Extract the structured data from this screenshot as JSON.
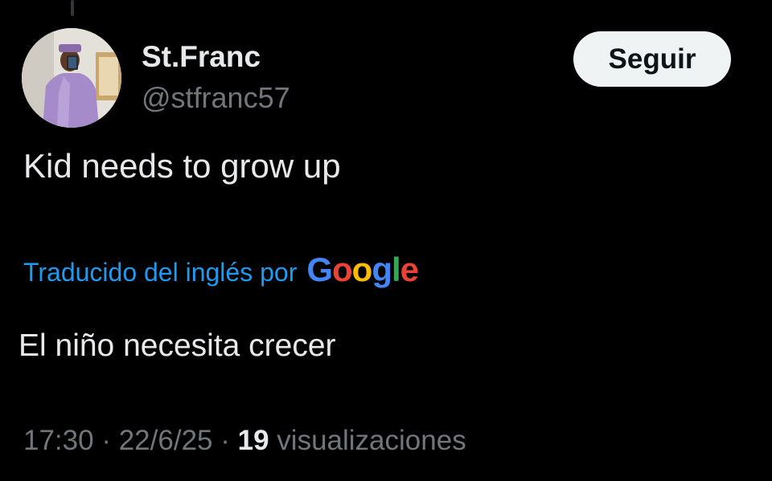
{
  "author": {
    "display_name": "St.Franc",
    "handle": "@stfranc57"
  },
  "follow_button": {
    "label": "Seguir"
  },
  "tweet": {
    "text": "Kid needs to grow up"
  },
  "translation": {
    "label": "Traducido del inglés por",
    "provider_logo": "Google",
    "text": "El niño necesita crecer"
  },
  "meta": {
    "time": "17:30",
    "separator": "·",
    "date": "22/6/25",
    "views_count": "19",
    "views_label": "visualizaciones"
  },
  "colors": {
    "background": "#000000",
    "primary_text": "#e7e9ea",
    "secondary_text": "#71767b",
    "link_blue": "#1d9bf0",
    "button_bg": "#eff3f4"
  }
}
